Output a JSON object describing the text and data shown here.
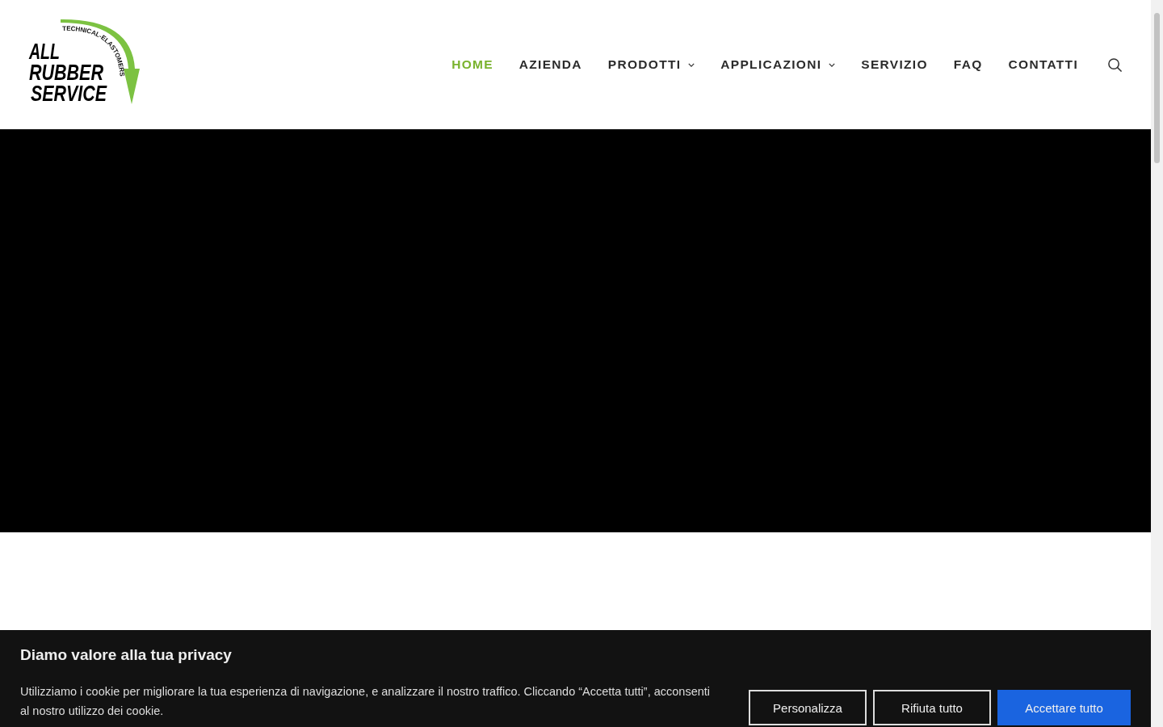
{
  "logo": {
    "line_1": "ALL",
    "line_2": "RUBBER",
    "line_3": "SERVICE",
    "tagline": "TECHNICAL-ELASTOMERS"
  },
  "nav": [
    {
      "label": "HOME",
      "selected": true,
      "dropdown": false
    },
    {
      "label": "AZIENDA",
      "selected": false,
      "dropdown": false
    },
    {
      "label": "PRODOTTI",
      "selected": false,
      "dropdown": true
    },
    {
      "label": "APPLICAZIONI",
      "selected": false,
      "dropdown": true
    },
    {
      "label": "SERVIZIO",
      "selected": false,
      "dropdown": false
    },
    {
      "label": "FAQ",
      "selected": false,
      "dropdown": false
    },
    {
      "label": "CONTATTI",
      "selected": false,
      "dropdown": false
    }
  ],
  "hero": {
    "kind": "video"
  },
  "cookie_banner": {
    "title": "Diamo valore alla tua privacy",
    "text": "Utilizziamo i cookie per migliorare la tua esperienza di navigazione, e analizzare il nostro traffico. Cliccando “Accetta tutti”, acconsenti al nostro utilizzo dei cookie.",
    "buttons": [
      {
        "label": "Personalizza",
        "kind": "outline"
      },
      {
        "label": "Rifiuta tutto",
        "kind": "outline"
      },
      {
        "label": "Accettare tutto",
        "kind": "primary"
      }
    ]
  }
}
